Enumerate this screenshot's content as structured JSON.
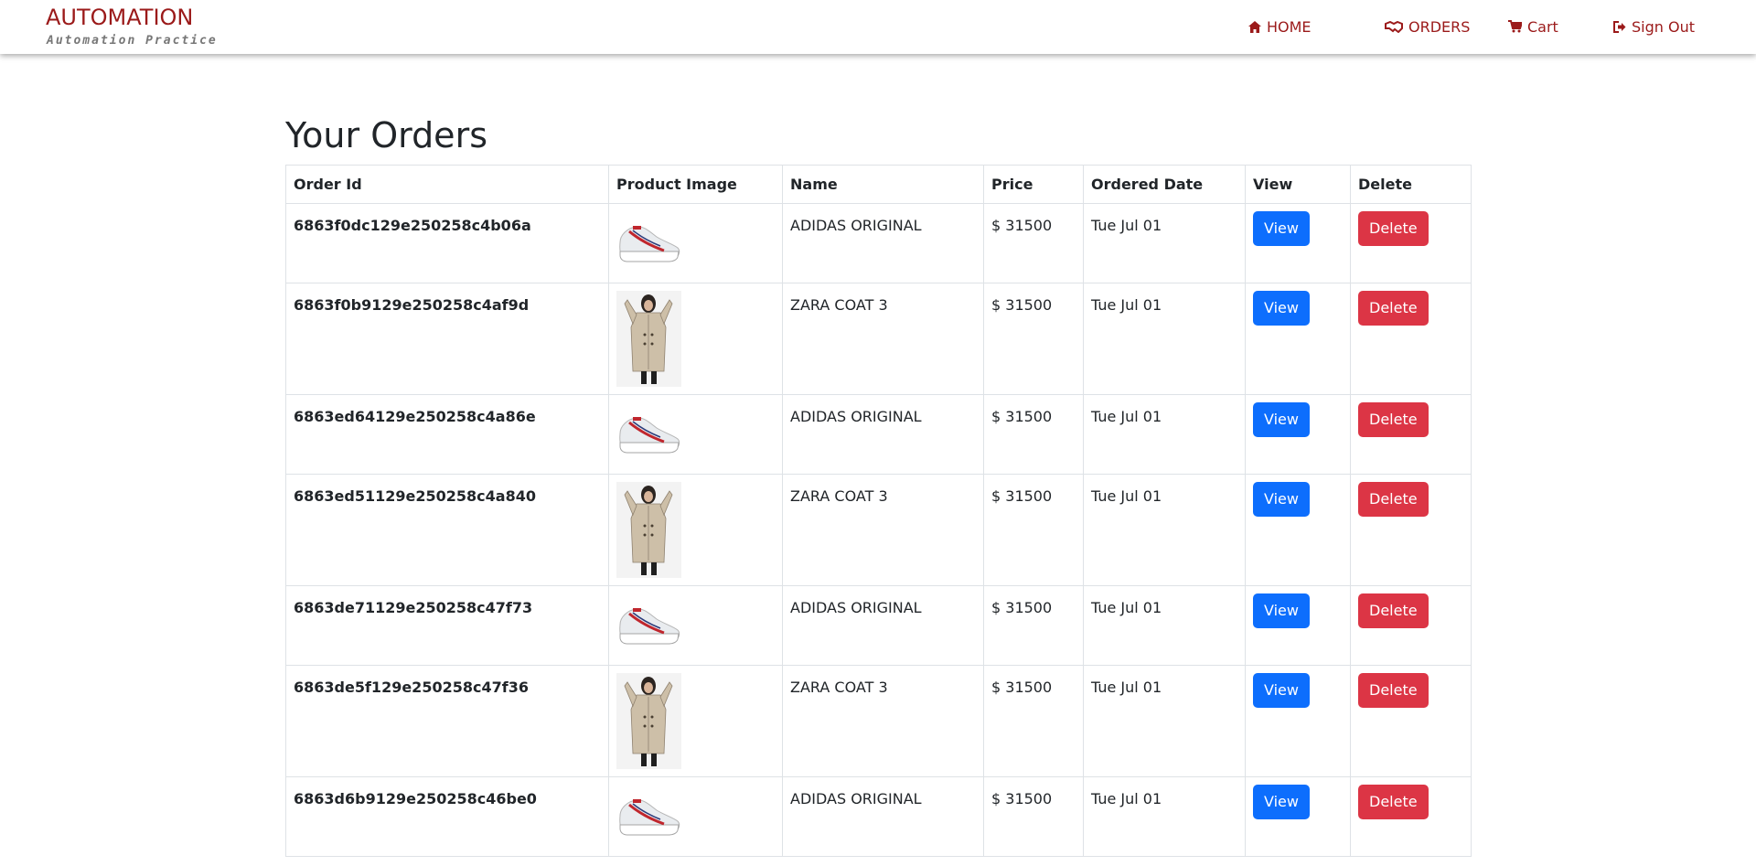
{
  "header": {
    "brand_title": "AUTOMATION",
    "brand_subtitle": "Automation Practice",
    "nav": {
      "home": "HOME",
      "orders": "ORDERS",
      "cart": "Cart",
      "signout": "Sign Out"
    }
  },
  "main": {
    "heading": "Your Orders",
    "columns": [
      "Order Id",
      "Product Image",
      "Name",
      "Price",
      "Ordered Date",
      "View",
      "Delete"
    ],
    "rows": [
      {
        "order_id": "6863f0dc129e250258c4b06a",
        "image": "shoe",
        "name": "ADIDAS ORIGINAL",
        "price": "$ 31500",
        "date": "Tue Jul 01",
        "view": "View",
        "delete": "Delete"
      },
      {
        "order_id": "6863f0b9129e250258c4af9d",
        "image": "coat",
        "name": "ZARA COAT 3",
        "price": "$ 31500",
        "date": "Tue Jul 01",
        "view": "View",
        "delete": "Delete"
      },
      {
        "order_id": "6863ed64129e250258c4a86e",
        "image": "shoe",
        "name": "ADIDAS ORIGINAL",
        "price": "$ 31500",
        "date": "Tue Jul 01",
        "view": "View",
        "delete": "Delete"
      },
      {
        "order_id": "6863ed51129e250258c4a840",
        "image": "coat",
        "name": "ZARA COAT 3",
        "price": "$ 31500",
        "date": "Tue Jul 01",
        "view": "View",
        "delete": "Delete"
      },
      {
        "order_id": "6863de71129e250258c47f73",
        "image": "shoe",
        "name": "ADIDAS ORIGINAL",
        "price": "$ 31500",
        "date": "Tue Jul 01",
        "view": "View",
        "delete": "Delete"
      },
      {
        "order_id": "6863de5f129e250258c47f36",
        "image": "coat",
        "name": "ZARA COAT 3",
        "price": "$ 31500",
        "date": "Tue Jul 01",
        "view": "View",
        "delete": "Delete"
      },
      {
        "order_id": "6863d6b9129e250258c46be0",
        "image": "shoe",
        "name": "ADIDAS ORIGINAL",
        "price": "$ 31500",
        "date": "Tue Jul 01",
        "view": "View",
        "delete": "Delete"
      }
    ]
  },
  "colors": {
    "brand": "#9b1a1a",
    "view_button": "#0d6efd",
    "delete_button": "#dc3545"
  },
  "icons": {
    "home": "home-icon",
    "orders": "handshake-icon",
    "cart": "cart-icon",
    "signout": "sign-out-icon"
  }
}
